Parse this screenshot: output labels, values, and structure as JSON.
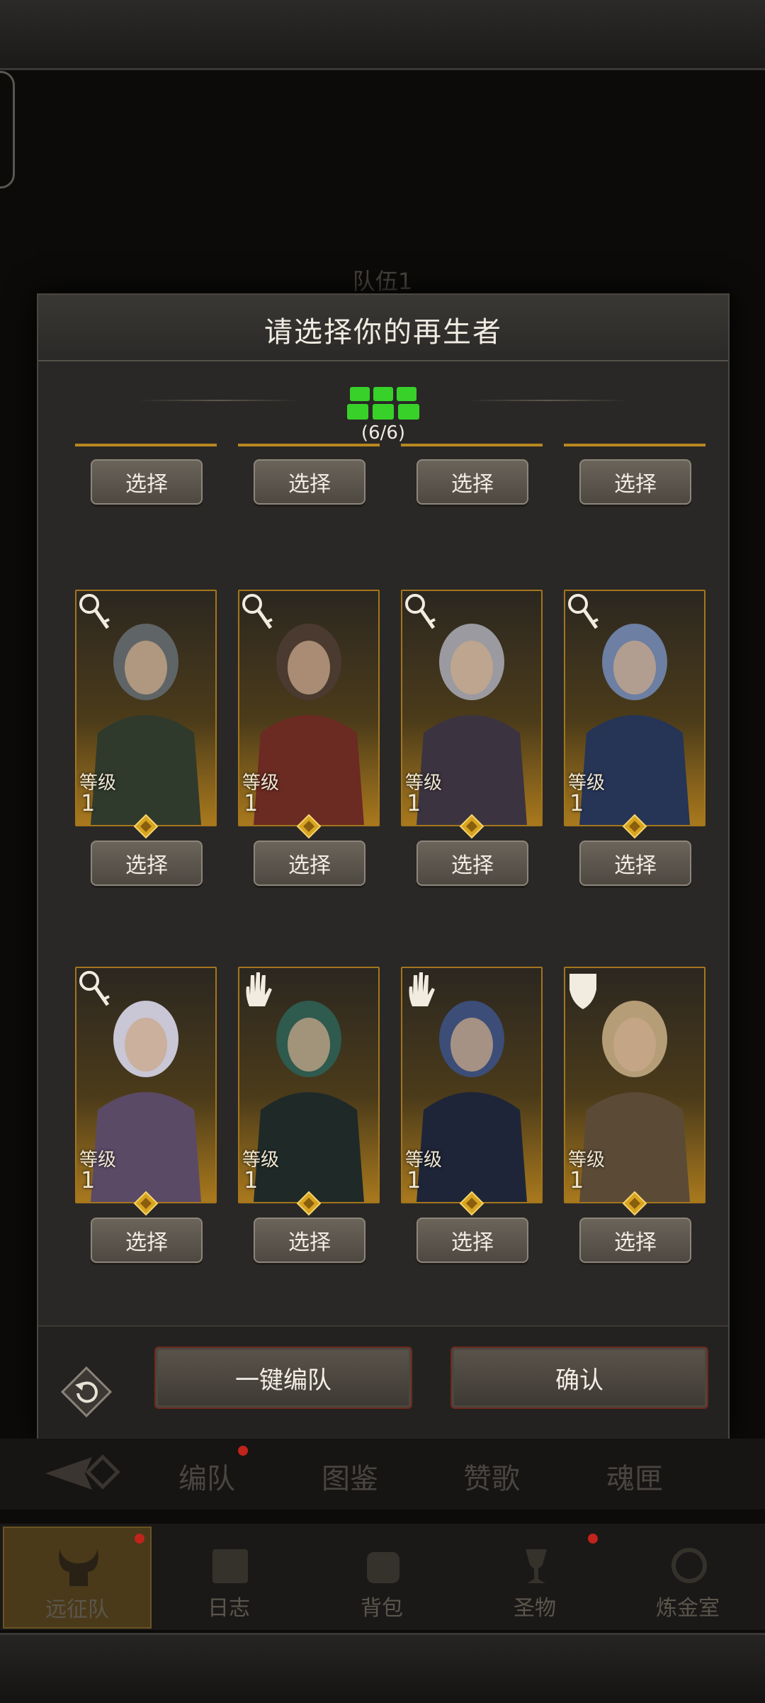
{
  "background": {
    "team_title": "队伍1"
  },
  "modal": {
    "title": "请选择你的再生者",
    "counter": "(6/6)",
    "select_label": "选择",
    "level_label": "等级",
    "auto_team_label": "一键编队",
    "confirm_label": "确认"
  },
  "heroes": [
    {
      "level": "1",
      "class_icon": "key-icon"
    },
    {
      "level": "1",
      "class_icon": "key-icon"
    },
    {
      "level": "1",
      "class_icon": "key-icon"
    },
    {
      "level": "1",
      "class_icon": "key-icon"
    },
    {
      "level": "1",
      "class_icon": "key-icon"
    },
    {
      "level": "1",
      "class_icon": "hand-icon"
    },
    {
      "level": "1",
      "class_icon": "hand-icon"
    },
    {
      "level": "1",
      "class_icon": "shield-icon"
    }
  ],
  "sub_tabs": {
    "formation": "编队",
    "codex": "图鉴",
    "hymn": "赞歌",
    "soul_box": "魂匣"
  },
  "main_nav": {
    "expedition": "远征队",
    "journal": "日志",
    "backpack": "背包",
    "relic": "圣物",
    "alchemy": "炼金室"
  },
  "colors": {
    "accent_gold": "#b8881f",
    "counter_green": "#37d12a",
    "notification_red": "#c0241b"
  }
}
